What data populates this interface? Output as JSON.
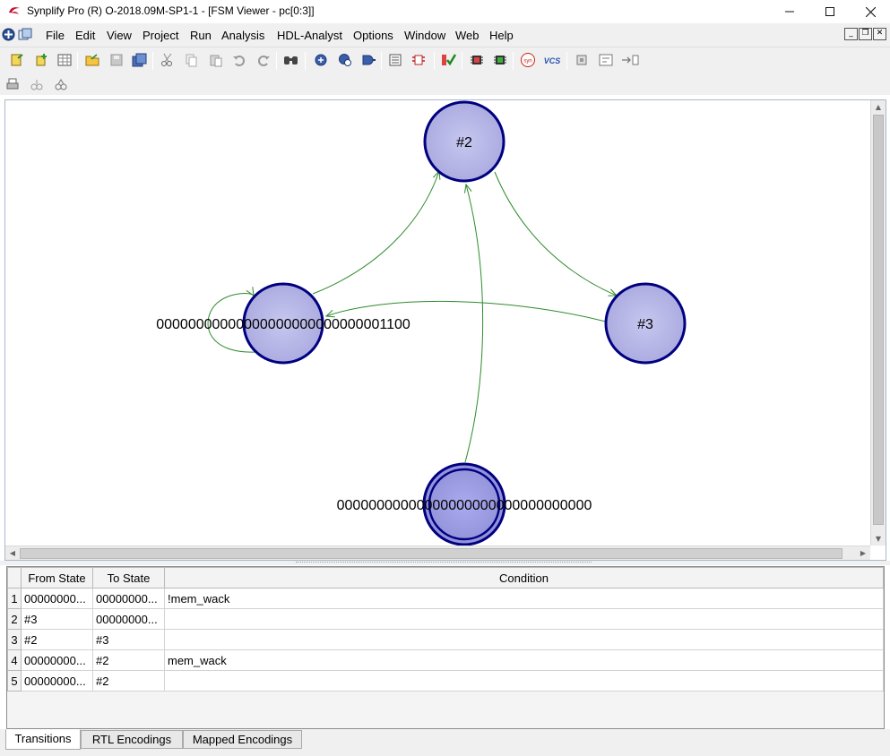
{
  "window": {
    "title": "Synplify Pro (R) O-2018.09M-SP1-1 - [FSM Viewer - pc[0:3]]",
    "controls": [
      "minimize-icon",
      "maximize-icon",
      "close-icon"
    ]
  },
  "menubar": {
    "items": [
      "File",
      "Edit",
      "View",
      "Project",
      "Run",
      "Analysis",
      "HDL-Analyst",
      "Options",
      "Window",
      "Web",
      "Help"
    ],
    "mdi_controls": [
      "mdi-minimize-icon",
      "mdi-restore-icon",
      "mdi-close-icon"
    ]
  },
  "toolbar": {
    "icons": [
      "new-project-icon",
      "add-file-icon",
      "grid-icon",
      "open-icon",
      "save-icon",
      "save-all-icon",
      "cut-icon",
      "copy-icon",
      "paste-icon",
      "undo-icon",
      "redo-icon",
      "find-icon",
      "zoom-in-icon",
      "zoom-out-icon",
      "rtl-view-icon",
      "text-editor-icon",
      "constraint-icon",
      "check-icon",
      "chip-icon",
      "chip-alt-icon",
      "syn-icon",
      "vcs-icon",
      "settings-chip-icon",
      "hierarchy-icon",
      "export-icon"
    ],
    "vcs_label": "VCS",
    "syn_label": "syn"
  },
  "toolbar2": {
    "icons": [
      "print-icon",
      "cross-probe-icon",
      "filter-icon"
    ]
  },
  "fsm": {
    "states": [
      {
        "id": "s0",
        "label": "#2",
        "initial": false
      },
      {
        "id": "s1",
        "label": "00000000000000000000000000001100",
        "initial": false
      },
      {
        "id": "s2",
        "label": "#3",
        "initial": false
      },
      {
        "id": "s3",
        "label": "00000000000000000000000000000000",
        "initial": true
      }
    ],
    "colors": {
      "node_fill": "#b3b3e6",
      "node_stroke": "#000080",
      "edge": "#2e8b2e"
    }
  },
  "table": {
    "headers": [
      "From State",
      "To State",
      "Condition"
    ],
    "rows": [
      {
        "num": "1",
        "from": "00000000...",
        "to": "00000000...",
        "condition": "!mem_wack"
      },
      {
        "num": "2",
        "from": "#3",
        "to": "00000000...",
        "condition": ""
      },
      {
        "num": "3",
        "from": "#2",
        "to": "#3",
        "condition": ""
      },
      {
        "num": "4",
        "from": "00000000...",
        "to": "#2",
        "condition": "mem_wack"
      },
      {
        "num": "5",
        "from": "00000000...",
        "to": "#2",
        "condition": ""
      }
    ]
  },
  "tabs": [
    "Transitions",
    "RTL Encodings",
    "Mapped Encodings"
  ],
  "active_tab": "Transitions"
}
